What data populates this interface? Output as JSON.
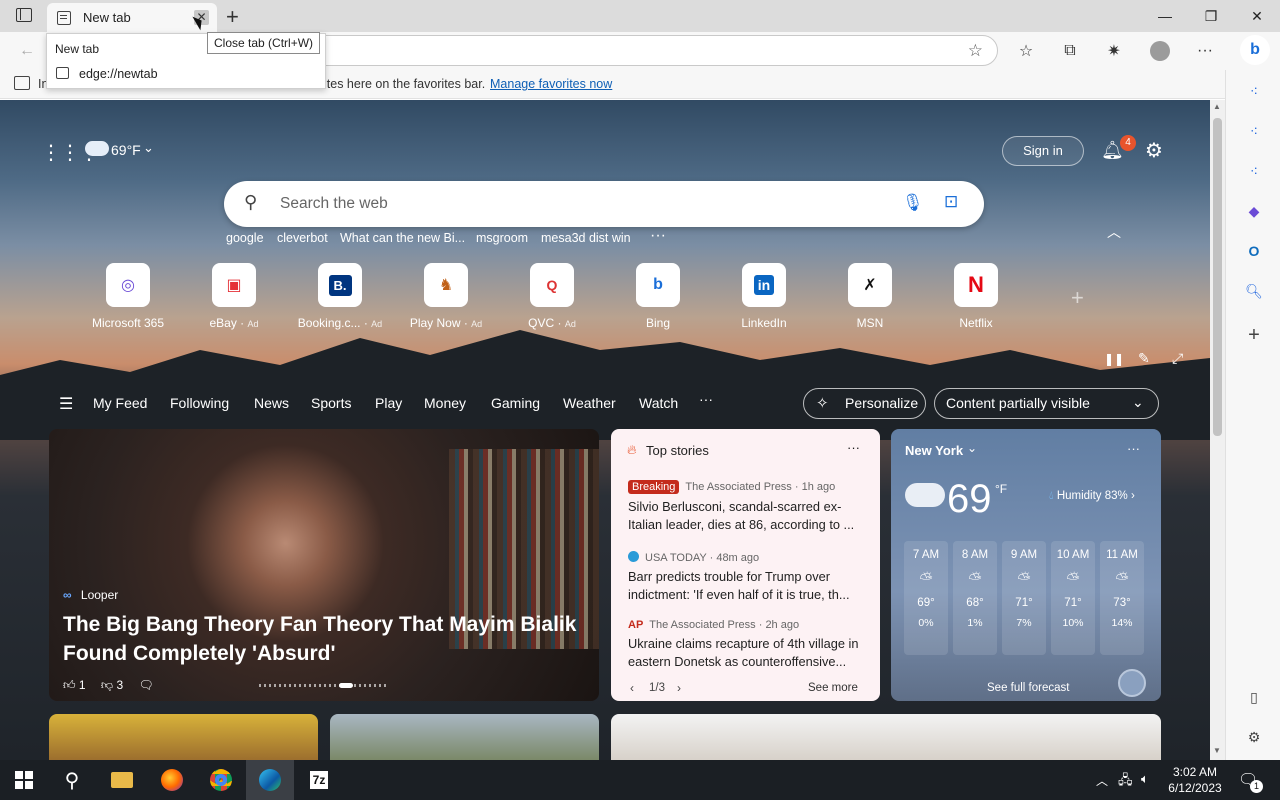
{
  "browser": {
    "tab_title": "New tab",
    "tooltip": "Close tab (Ctrl+W)",
    "hover_title": "New tab",
    "hover_url": "edge://newtab",
    "favbar_text": "In",
    "favbar_message": "ites here on the favorites bar.",
    "favbar_link": "Manage favorites now"
  },
  "newtab": {
    "temperature": "69°F",
    "sign_in": "Sign in",
    "notification_count": "4",
    "search_placeholder": "Search the web",
    "quick_searches": [
      "google",
      "cleverbot",
      "What can the new Bi...",
      "msgroom",
      "mesa3d dist win"
    ],
    "tiles": [
      {
        "label": "Microsoft 365",
        "ad": ""
      },
      {
        "label": "eBay",
        "ad": "Ad"
      },
      {
        "label": "Booking.c...",
        "ad": "Ad"
      },
      {
        "label": "Play Now",
        "ad": "Ad"
      },
      {
        "label": "QVC",
        "ad": "Ad"
      },
      {
        "label": "Bing",
        "ad": ""
      },
      {
        "label": "LinkedIn",
        "ad": ""
      },
      {
        "label": "MSN",
        "ad": ""
      },
      {
        "label": "Netflix",
        "ad": ""
      }
    ],
    "feed_nav": [
      "My Feed",
      "Following",
      "News",
      "Sports",
      "Play",
      "Money",
      "Gaming",
      "Weather",
      "Watch",
      "···"
    ],
    "personalize": "Personalize",
    "content_visibility": "Content partially visible"
  },
  "hero": {
    "source": "Looper",
    "headline": "The Big Bang Theory Fan Theory That Mayim Bialik Found Completely 'Absurd'",
    "likes": "1",
    "dislikes": "3"
  },
  "top_stories": {
    "header": "Top stories",
    "items": [
      {
        "badge": "Breaking",
        "source": "The Associated Press · 1h ago",
        "title": "Silvio Berlusconi, scandal-scarred ex-Italian leader, dies at 86, according to ..."
      },
      {
        "badge": "",
        "source": "USA TODAY · 48m ago",
        "title": "Barr predicts trouble for Trump over indictment: 'If even half of it is true, th..."
      },
      {
        "badge": "",
        "source": "The Associated Press · 2h ago",
        "title": "Ukraine claims recapture of 4th village in eastern Donetsk as counteroffensive..."
      }
    ],
    "pager": "1/3",
    "see_more": "See more"
  },
  "weather": {
    "city": "New York",
    "temp": "69",
    "unit": "°F",
    "humidity": "Humidity 83%",
    "hours": [
      {
        "time": "7 AM",
        "temp": "69°",
        "precip": "0%"
      },
      {
        "time": "8 AM",
        "temp": "68°",
        "precip": "1%"
      },
      {
        "time": "9 AM",
        "temp": "71°",
        "precip": "7%"
      },
      {
        "time": "10 AM",
        "temp": "71°",
        "precip": "10%"
      },
      {
        "time": "11 AM",
        "temp": "73°",
        "precip": "14%"
      }
    ],
    "forecast_link": "See full forecast"
  },
  "taskbar": {
    "time": "3:02 AM",
    "date": "6/12/2023",
    "notif_count": "1"
  },
  "colors": {
    "accent": "#0f5fb5",
    "breaking": "#c42b1c",
    "taskbar": "#1b1f24"
  }
}
